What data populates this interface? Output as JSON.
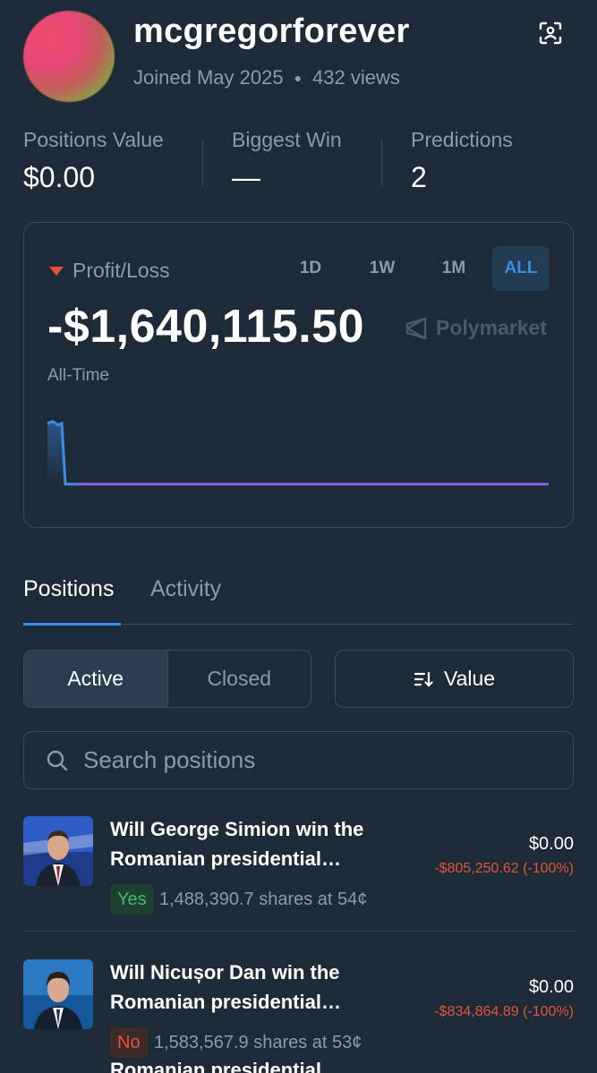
{
  "profile": {
    "username": "mcgregorforever",
    "joined": "Joined May 2025",
    "views": "432 views"
  },
  "stats": [
    {
      "label": "Positions Value",
      "value": "$0.00"
    },
    {
      "label": "Biggest Win",
      "value": "—"
    },
    {
      "label": "Predictions",
      "value": "2"
    }
  ],
  "pnl": {
    "label": "Profit/Loss",
    "value": "-$1,640,115.50",
    "period": "All-Time",
    "brand": "Polymarket",
    "ranges": [
      "1D",
      "1W",
      "1M",
      "ALL"
    ],
    "active_range": "ALL"
  },
  "chart_data": {
    "type": "line",
    "series_color": "#8a5cf0",
    "start_color": "#3b8ee6",
    "description_points": [
      1.0,
      0.98,
      1.0,
      0.0,
      0.0,
      0.0,
      0.0,
      0.0
    ]
  },
  "tabs": [
    {
      "label": "Positions",
      "active": true
    },
    {
      "label": "Activity",
      "active": false
    }
  ],
  "filters": {
    "active_label": "Active",
    "closed_label": "Closed",
    "sort_label": "Value"
  },
  "search": {
    "placeholder": "Search positions"
  },
  "positions": [
    {
      "title_line1": "Will George Simion win the",
      "title_line2": "Romanian presidential…",
      "outcome": "Yes",
      "shares": "1,488,390.7 shares at 54¢",
      "value": "$0.00",
      "pnl": "-$805,250.62 (-100%)"
    },
    {
      "title_line1": "Will Nicușor Dan win the",
      "title_line2": "Romanian presidential…",
      "outcome": "No",
      "shares": "1,583,567.9 shares at 53¢",
      "value": "$0.00",
      "pnl": "-$834,864.89 (-100%)"
    }
  ],
  "cut_off_text": "Romanian presidential…",
  "colors": {
    "background": "#1d2b39",
    "accent": "#3b8ee6",
    "loss": "#e5533c",
    "gain": "#3cbf6a"
  }
}
